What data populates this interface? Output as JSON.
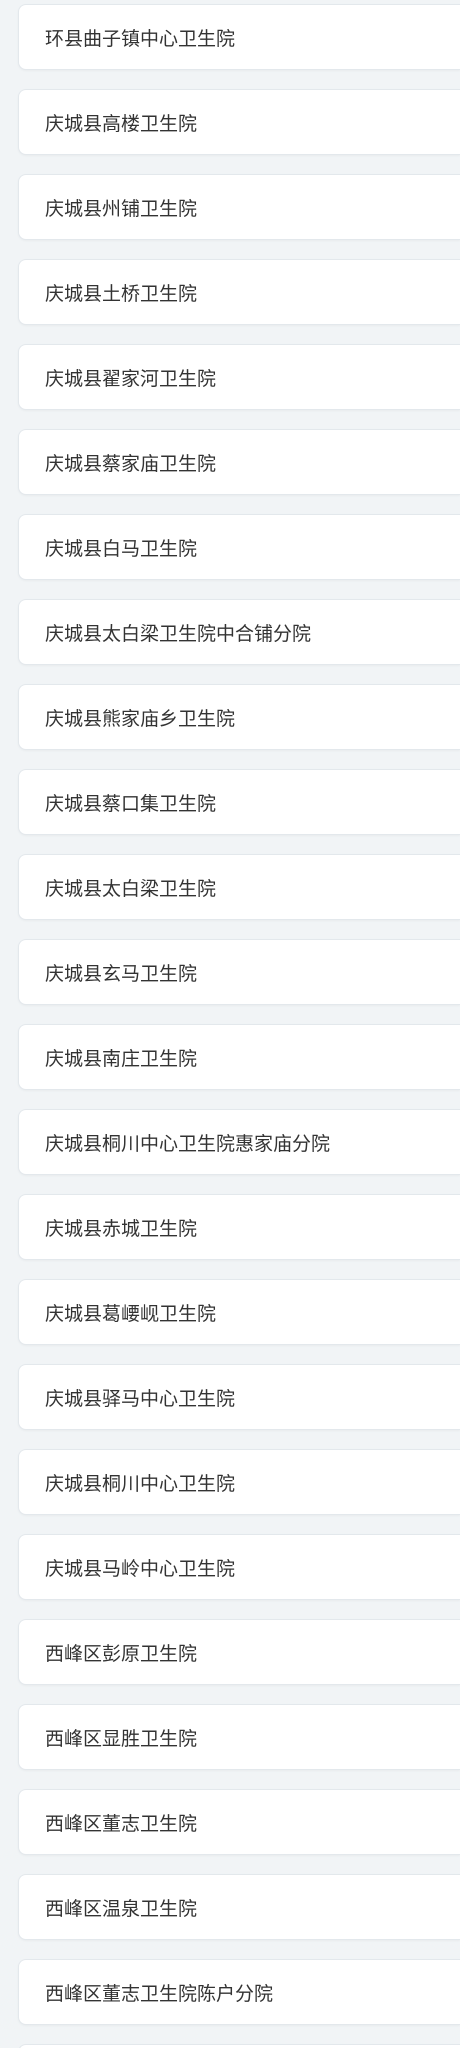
{
  "hospital_list": {
    "items": [
      {
        "label": "环县曲子镇中心卫生院"
      },
      {
        "label": "庆城县高楼卫生院"
      },
      {
        "label": "庆城县州铺卫生院"
      },
      {
        "label": "庆城县土桥卫生院"
      },
      {
        "label": "庆城县翟家河卫生院"
      },
      {
        "label": "庆城县蔡家庙卫生院"
      },
      {
        "label": "庆城县白马卫生院"
      },
      {
        "label": "庆城县太白梁卫生院中合铺分院"
      },
      {
        "label": "庆城县熊家庙乡卫生院"
      },
      {
        "label": "庆城县蔡口集卫生院"
      },
      {
        "label": "庆城县太白梁卫生院"
      },
      {
        "label": "庆城县玄马卫生院"
      },
      {
        "label": "庆城县南庄卫生院"
      },
      {
        "label": "庆城县桐川中心卫生院惠家庙分院"
      },
      {
        "label": "庆城县赤城卫生院"
      },
      {
        "label": "庆城县葛崾岘卫生院"
      },
      {
        "label": "庆城县驿马中心卫生院"
      },
      {
        "label": "庆城县桐川中心卫生院"
      },
      {
        "label": "庆城县马岭中心卫生院"
      },
      {
        "label": "西峰区彭原卫生院"
      },
      {
        "label": "西峰区显胜卫生院"
      },
      {
        "label": "西峰区董志卫生院"
      },
      {
        "label": "西峰区温泉卫生院"
      },
      {
        "label": "西峰区董志卫生院陈户分院"
      }
    ]
  }
}
